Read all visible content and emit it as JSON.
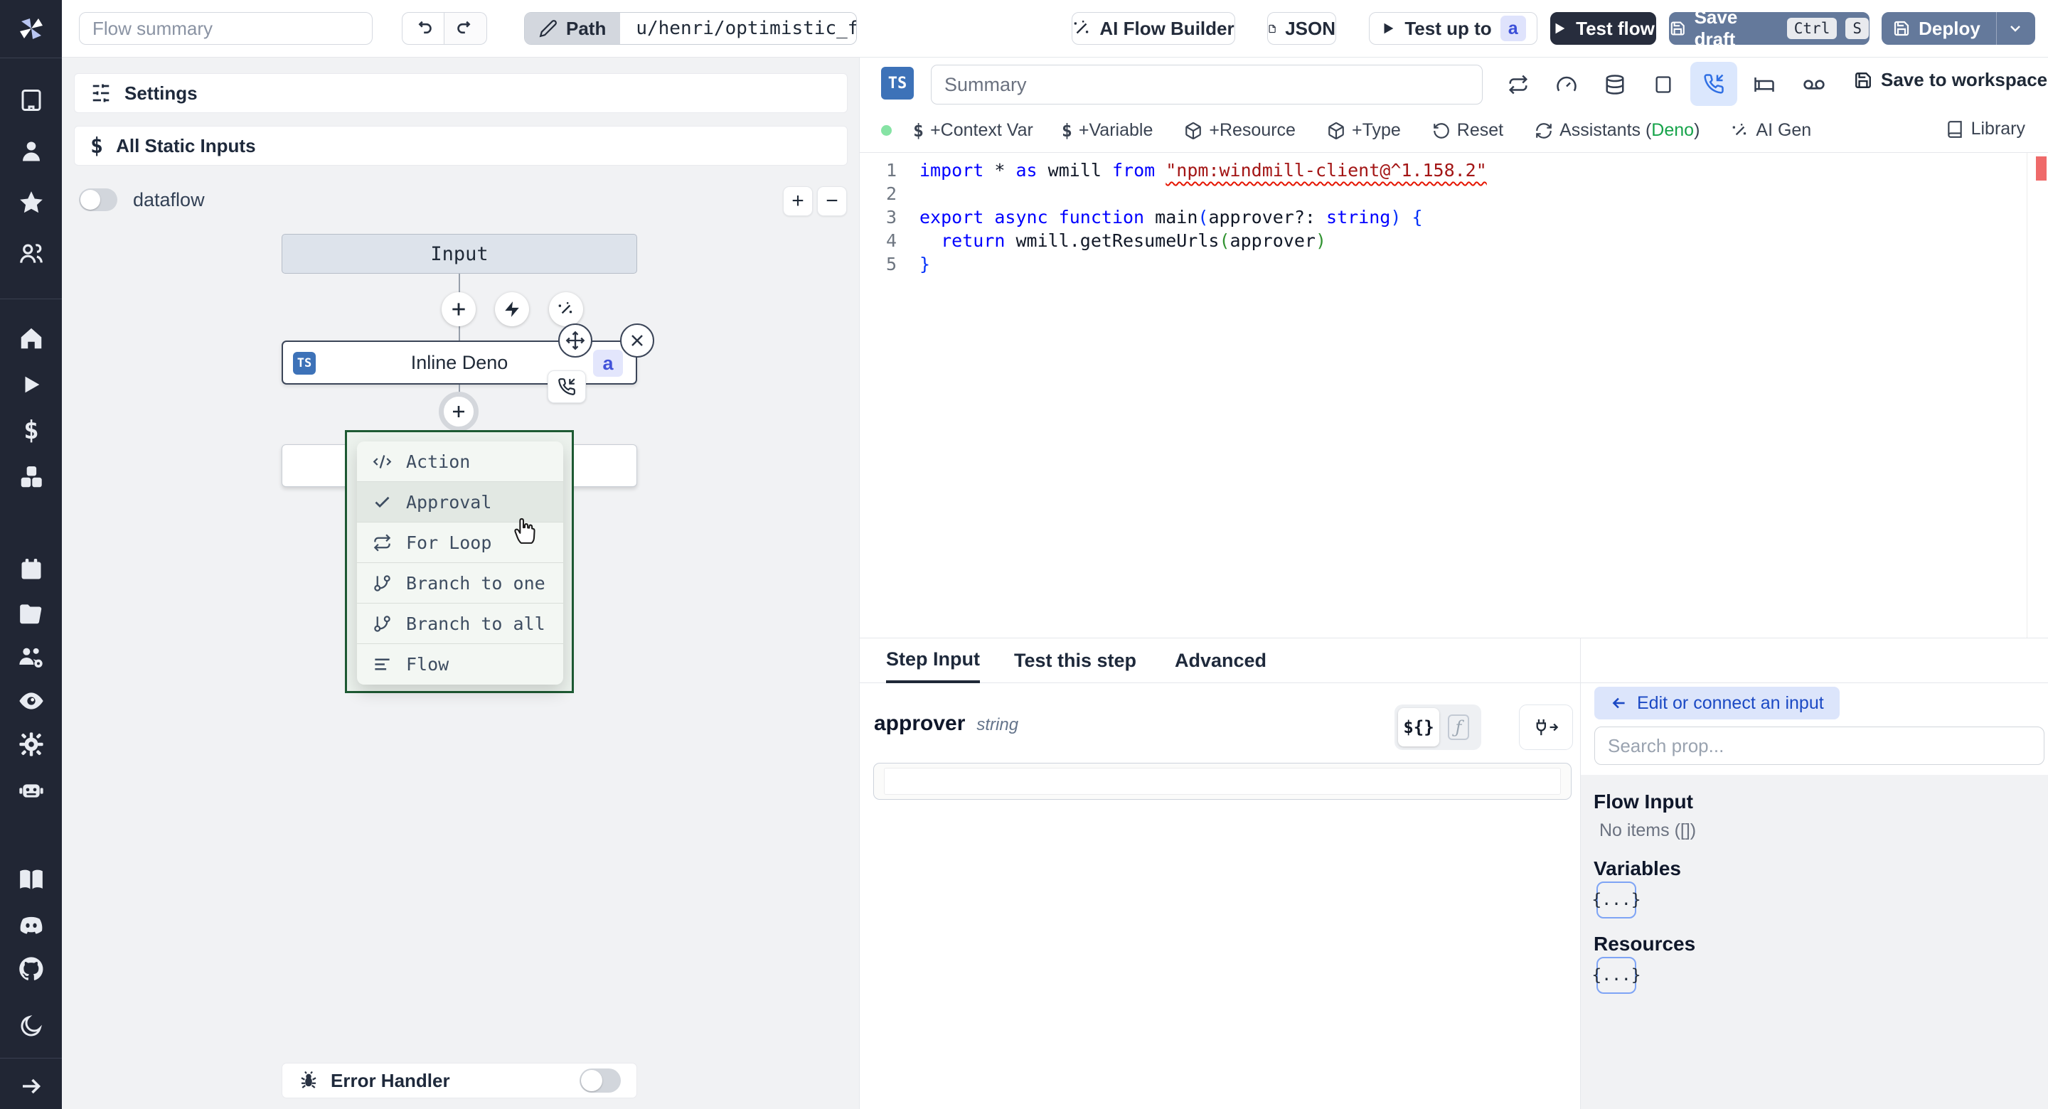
{
  "colors": {
    "sidebar_bg": "#212634",
    "canvas_bg": "#f1f2f4",
    "dark_button": "#272d3d",
    "slate_button": "#64799b",
    "ts_badge_blue": "#3d72b8",
    "badge_lavender_bg": "#e3e6fc",
    "badge_lavender_text": "#4353d9",
    "menu_border_green": "#1d5a33",
    "deno_green": "#16a34a",
    "suspend_blue": "#2f6fe4",
    "error_red": "#e51400",
    "keyword_blue": "#0000ff",
    "string_red": "#a31515"
  },
  "sidebar": {
    "icons": [
      "windmill-logo",
      "building",
      "user",
      "star",
      "users",
      "home",
      "play",
      "dollar",
      "cubes",
      "calendar",
      "folder-open",
      "users-gear",
      "eye",
      "gear",
      "robot",
      "book-open",
      "discord",
      "github",
      "moon",
      "arrow-right"
    ]
  },
  "topbar": {
    "flow_summary_placeholder": "Flow summary",
    "path_label": "Path",
    "path_value": "u/henri/optimistic_flow",
    "ai_flow_builder": "AI Flow Builder",
    "json": "JSON",
    "test_up_to": "Test up to",
    "test_up_to_badge": "a",
    "test_flow": "Test flow",
    "save_draft": "Save draft",
    "kbd_ctrl": "Ctrl",
    "kbd_s": "S",
    "deploy": "Deploy"
  },
  "canvas": {
    "settings_label": "Settings",
    "static_inputs_label": "All Static Inputs",
    "dataflow_label": "dataflow",
    "zoom_in_label": "+",
    "zoom_out_label": "−",
    "input_node_label": "Input",
    "deno_node": {
      "badge": "TS",
      "label": "Inline Deno",
      "suffix_badge": "a"
    },
    "menu": {
      "items": [
        {
          "icon": "code-icon",
          "label": "Action"
        },
        {
          "icon": "check-icon",
          "label": "Approval",
          "highlighted": true
        },
        {
          "icon": "repeat-icon",
          "label": "For Loop"
        },
        {
          "icon": "git-branch-icon",
          "label": "Branch to one"
        },
        {
          "icon": "git-branch-icon",
          "label": "Branch to all"
        },
        {
          "icon": "menu-lines-icon",
          "label": "Flow"
        }
      ]
    },
    "error_handler_label": "Error Handler"
  },
  "editor": {
    "lang_badge": "TS",
    "summary_placeholder": "Summary",
    "header_icons": [
      "repeat-icon",
      "gauge-icon",
      "database-icon",
      "square-icon",
      "phone-incoming-icon",
      "bed-icon",
      "voicemail-icon"
    ],
    "save_to_workspace": "Save to workspace",
    "toolbar": {
      "context_var": "+Context Var",
      "variable": "+Variable",
      "resource": "+Resource",
      "type": "+Type",
      "reset": "Reset",
      "assistants_prefix": "Assistants (",
      "assistants_lang": "Deno",
      "assistants_suffix": ")",
      "ai_gen": "AI Gen",
      "library": "Library"
    },
    "code": {
      "lines": [
        [
          [
            "import",
            "kw"
          ],
          [
            " ",
            ""
          ],
          [
            "*",
            ""
          ],
          [
            " ",
            ""
          ],
          [
            "as",
            "kw"
          ],
          [
            " wmill ",
            ""
          ],
          [
            "from",
            "kw"
          ],
          [
            " ",
            ""
          ],
          [
            "\"npm:windmill-client@^1.158.2\"",
            "str err"
          ]
        ],
        [],
        [
          [
            "export",
            "kw"
          ],
          [
            " ",
            ""
          ],
          [
            "async",
            "kw"
          ],
          [
            " ",
            ""
          ],
          [
            "function",
            "kw"
          ],
          [
            " main",
            ""
          ],
          [
            "(",
            "b1"
          ],
          [
            "approver?: ",
            ""
          ],
          [
            "string",
            "kw"
          ],
          [
            ")",
            "b1"
          ],
          [
            " {",
            "b1"
          ]
        ],
        [
          [
            "  ",
            ""
          ],
          [
            "return",
            "kw"
          ],
          [
            " wmill.getResumeUrls",
            ""
          ],
          [
            "(",
            "b2"
          ],
          [
            "approver",
            ""
          ],
          [
            ")",
            "b2"
          ]
        ],
        [
          [
            "}",
            "b1"
          ]
        ]
      ]
    }
  },
  "bottom": {
    "tabs": [
      "Step Input",
      "Test this step",
      "Advanced"
    ],
    "active_tab": "Step Input",
    "field_name": "approver",
    "field_type": "string",
    "expr_toggle": "${}",
    "fn_toggle": "ƒ",
    "edit_connect_label": "Edit or connect an input",
    "search_placeholder": "Search prop...",
    "flow_input_heading": "Flow Input",
    "flow_input_empty": "No items ([])",
    "variables_heading": "Variables",
    "resources_heading": "Resources",
    "object_chip": "{...}"
  }
}
